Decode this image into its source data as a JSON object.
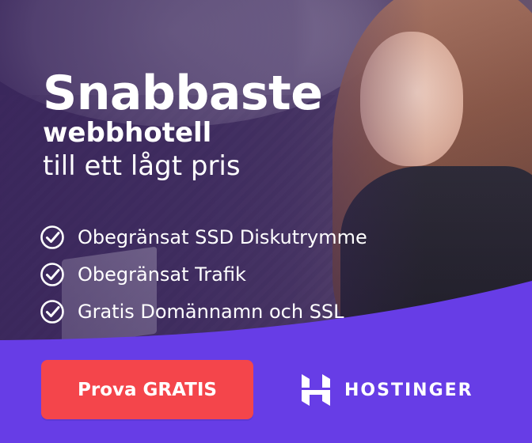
{
  "headline": {
    "line1": "Snabbaste",
    "line2": "webbhotell",
    "line3": "till ett lågt pris"
  },
  "features": [
    {
      "icon": "check-circle-icon",
      "label": "Obegränsat SSD Diskutrymme"
    },
    {
      "icon": "check-circle-icon",
      "label": "Obegränsat Trafik"
    },
    {
      "icon": "check-circle-icon",
      "label": "Gratis Domännamn och SSL"
    }
  ],
  "cta": {
    "label": "Prova GRATIS",
    "color": "#f4454b"
  },
  "brand": {
    "name": "HOSTINGER",
    "icon": "hostinger-logo-icon"
  },
  "colors": {
    "purple": "#673de6",
    "text": "#ffffff",
    "overlay": "#3a265c"
  }
}
